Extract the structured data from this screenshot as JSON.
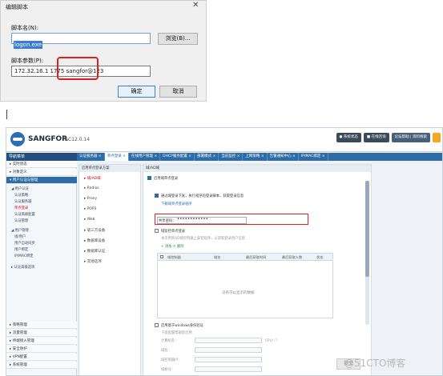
{
  "dialog": {
    "title": "编辑脚本",
    "close": "✕",
    "name_label": "脚本名(N):",
    "name_value": "logon.exe",
    "browse": "浏览(B)...",
    "param_label": "脚本参数(P):",
    "param_value": "172.32.16.1 1775 sangfor@123",
    "ok": "确定",
    "cancel": "取消"
  },
  "console": {
    "logo": "SANGFOR",
    "version": "AC12.0.14",
    "top_links": [
      "● 系统状态",
      "■ 在线咨询",
      "论坛帮助 | 资料搜索"
    ],
    "nav_title": "导航菜单",
    "tabs": [
      {
        "label": "认证服务器 ×",
        "active": false
      },
      {
        "label": "单点登录 ×",
        "active": true
      },
      {
        "label": "在线用户管理 ×",
        "active": false
      },
      {
        "label": "DHCP服务配置 ×",
        "active": false
      },
      {
        "label": "部署模式 ×",
        "active": false
      },
      {
        "label": "当前监控 ×",
        "active": false
      },
      {
        "label": "上网策略 ×",
        "active": false
      },
      {
        "label": "告警通知中心 ×",
        "active": false
      },
      {
        "label": "IP/MAC绑定 ×",
        "active": false
      }
    ],
    "sidebar": {
      "top_heads": [
        "▸ 实时状态",
        "▸ 对象定义",
        "▾ 用户认证与管理"
      ],
      "items_a_title": "◢ 用户认证",
      "items_a": [
        "认证策略",
        "认证服务器",
        "单点登录",
        "认证高级配置",
        "认证管理"
      ],
      "items_b_title": "◢ 用户管理",
      "items_b": [
        "组/用户",
        "用户自动同步",
        "用户绑定",
        "IP/MAC绑定"
      ],
      "items_c": "▸ 认证高级选项",
      "bottom_heads": [
        "▸ 策略管理",
        "▸ 流量管理",
        "▸ 终端接入管理",
        "▸ 安全防护",
        "▸ VPN配置",
        "▸ 系统管理"
      ]
    },
    "col2": {
      "head": "启用单点登录方案",
      "items": [
        "▸ 域/AD域",
        "▸ Radius",
        "▸ Proxy",
        "▸ POP3",
        "▸ Web",
        "▸ 第三方设备",
        "▸ 数据库设备",
        "▸ 数据库认证",
        "▸ 其他选项"
      ]
    },
    "panel": {
      "head": "域/AD域",
      "enable": "启用域单点登录",
      "opt1": "通过域登录下发，执行程序的登录脚本，获取登录信息",
      "opt1_link": "下载域单点登录程序",
      "result_label": "共享密码：",
      "result_value": "••••••••••••",
      "opt2": "域监控单点登录",
      "opt2_hint": "本次用到AD域控制器上安装程序，以获取登录用户信息",
      "toolbar": "+ 添加  ✕ 删除",
      "table_cols": [
        "域控制器",
        "域名",
        "最后获取时间",
        "最后获取人数",
        "状态"
      ],
      "table_empty": "没有可以显示的数据",
      "opt3": "启用基于windows身份验证",
      "opt3_hint": "下面配置帮助您启用",
      "fields": [
        {
          "label": "计算机名：",
          "suffix": "CPU: ⓘ"
        },
        {
          "label": "域名：",
          "suffix": ""
        },
        {
          "label": "域控制器IP：",
          "suffix": ""
        },
        {
          "label": "域帐号：",
          "suffix": ""
        }
      ]
    }
  },
  "watermark": "@51CTO博客",
  "watermark_btn": "提交"
}
